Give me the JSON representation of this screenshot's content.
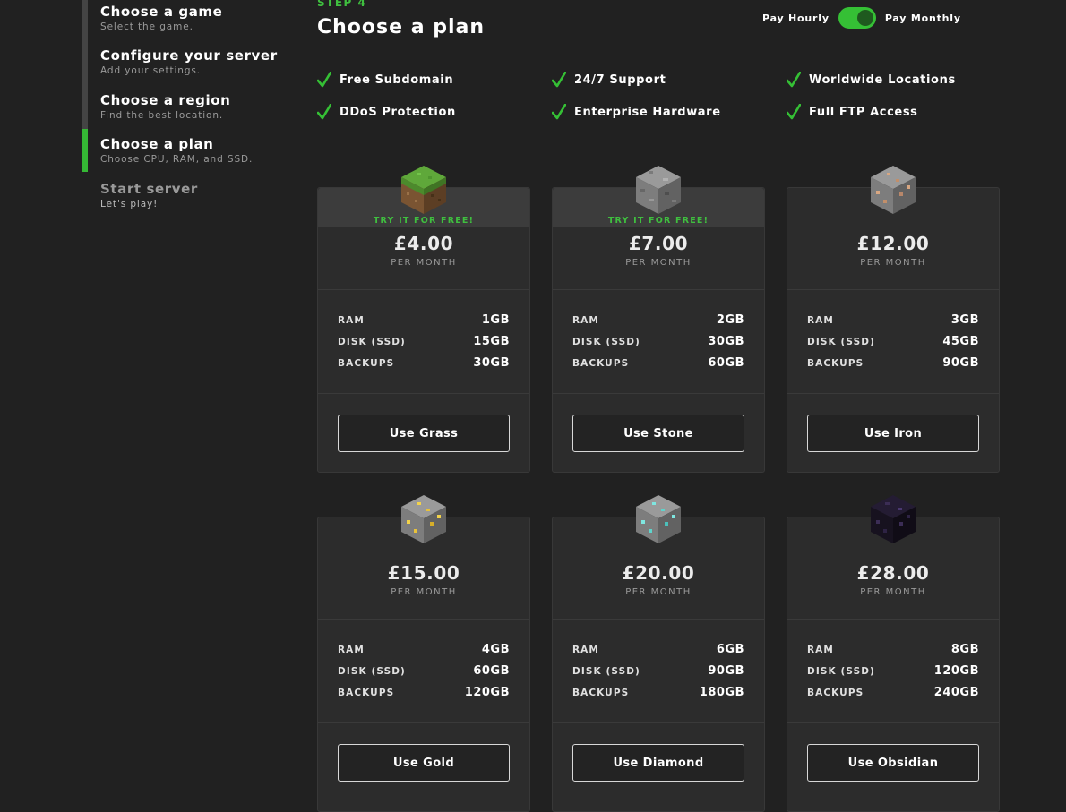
{
  "stepper": {
    "steps": [
      {
        "title": "Choose a game",
        "subtitle": "Select the game."
      },
      {
        "title": "Configure your server",
        "subtitle": "Add your settings."
      },
      {
        "title": "Choose a region",
        "subtitle": "Find the best location."
      },
      {
        "title": "Choose a plan",
        "subtitle": "Choose CPU, RAM, and SSD."
      },
      {
        "title": "Start server",
        "subtitle": "Let's play!"
      }
    ],
    "current_step": 4
  },
  "header": {
    "step_label": "STEP 4",
    "title": "Choose a plan",
    "billing_toggle": {
      "left_label": "Pay Hourly",
      "right_label": "Pay Monthly",
      "selected": "Pay Monthly"
    }
  },
  "features": [
    "Free Subdomain",
    "24/7 Support",
    "Worldwide Locations",
    "DDoS Protection",
    "Enterprise Hardware",
    "Full FTP Access"
  ],
  "plan_labels": {
    "per": "PER MONTH",
    "ram": "RAM",
    "disk": "DISK (SSD)",
    "backups": "BACKUPS",
    "promo": "TRY IT FOR FREE!"
  },
  "plans": [
    {
      "name": "Grass",
      "icon": "grass-block-icon",
      "price": "£4.00",
      "ram": "1GB",
      "disk": "15GB",
      "backups": "30GB",
      "button": "Use Grass",
      "promo": true
    },
    {
      "name": "Stone",
      "icon": "stone-block-icon",
      "price": "£7.00",
      "ram": "2GB",
      "disk": "30GB",
      "backups": "60GB",
      "button": "Use Stone",
      "promo": true
    },
    {
      "name": "Iron",
      "icon": "iron-ore-block-icon",
      "price": "£12.00",
      "ram": "3GB",
      "disk": "45GB",
      "backups": "90GB",
      "button": "Use Iron",
      "promo": false
    },
    {
      "name": "Gold",
      "icon": "gold-ore-block-icon",
      "price": "£15.00",
      "ram": "4GB",
      "disk": "60GB",
      "backups": "120GB",
      "button": "Use Gold",
      "promo": false
    },
    {
      "name": "Diamond",
      "icon": "diamond-ore-block-icon",
      "price": "£20.00",
      "ram": "6GB",
      "disk": "90GB",
      "backups": "180GB",
      "button": "Use Diamond",
      "promo": false
    },
    {
      "name": "Obsidian",
      "icon": "obsidian-block-icon",
      "price": "£28.00",
      "ram": "8GB",
      "disk": "120GB",
      "backups": "240GB",
      "button": "Use Obsidian",
      "promo": false
    }
  ],
  "colors": {
    "accent": "#3fbf3f",
    "background": "#212121",
    "card": "#2c2c2c"
  }
}
